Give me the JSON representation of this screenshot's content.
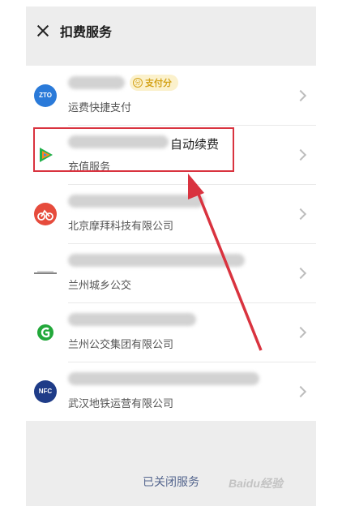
{
  "header": {
    "title": "扣费服务"
  },
  "services": [
    {
      "icon": "zto-express-logo-icon",
      "icon_text": "ZTO",
      "icon_color": "#2a7ad9",
      "title_visible": "",
      "badge": "支付分",
      "subtitle": "运费快捷支付"
    },
    {
      "icon": "tencent-video-logo-icon",
      "icon_text": "",
      "icon_color": "#ffffff",
      "title_visible": "自动续费",
      "badge": "",
      "subtitle": "充值服务"
    },
    {
      "icon": "mobike-logo-icon",
      "icon_text": "",
      "icon_color": "#e64b3c",
      "title_visible": "",
      "badge": "",
      "subtitle": "北京摩拜科技有限公司"
    },
    {
      "icon": "lanzhou-urban-bus-logo-icon",
      "icon_text": "",
      "icon_color": "#ffffff",
      "title_visible": "",
      "badge": "",
      "subtitle": "兰州城乡公交"
    },
    {
      "icon": "lanzhou-bus-group-logo-icon",
      "icon_text": "",
      "icon_color": "#22a83a",
      "title_visible": "",
      "badge": "",
      "subtitle": "兰州公交集团有限公司"
    },
    {
      "icon": "wuhan-metro-logo-icon",
      "icon_text": "NFC",
      "icon_color": "#1f3c88",
      "title_visible": "",
      "badge": "",
      "subtitle": "武汉地铁运营有限公司"
    }
  ],
  "footer": {
    "closed_services": "已关闭服务"
  },
  "watermark": "Baidu经验",
  "colors": {
    "highlight": "#d9333f",
    "arrow": "#d9333f",
    "link": "#55668e"
  }
}
